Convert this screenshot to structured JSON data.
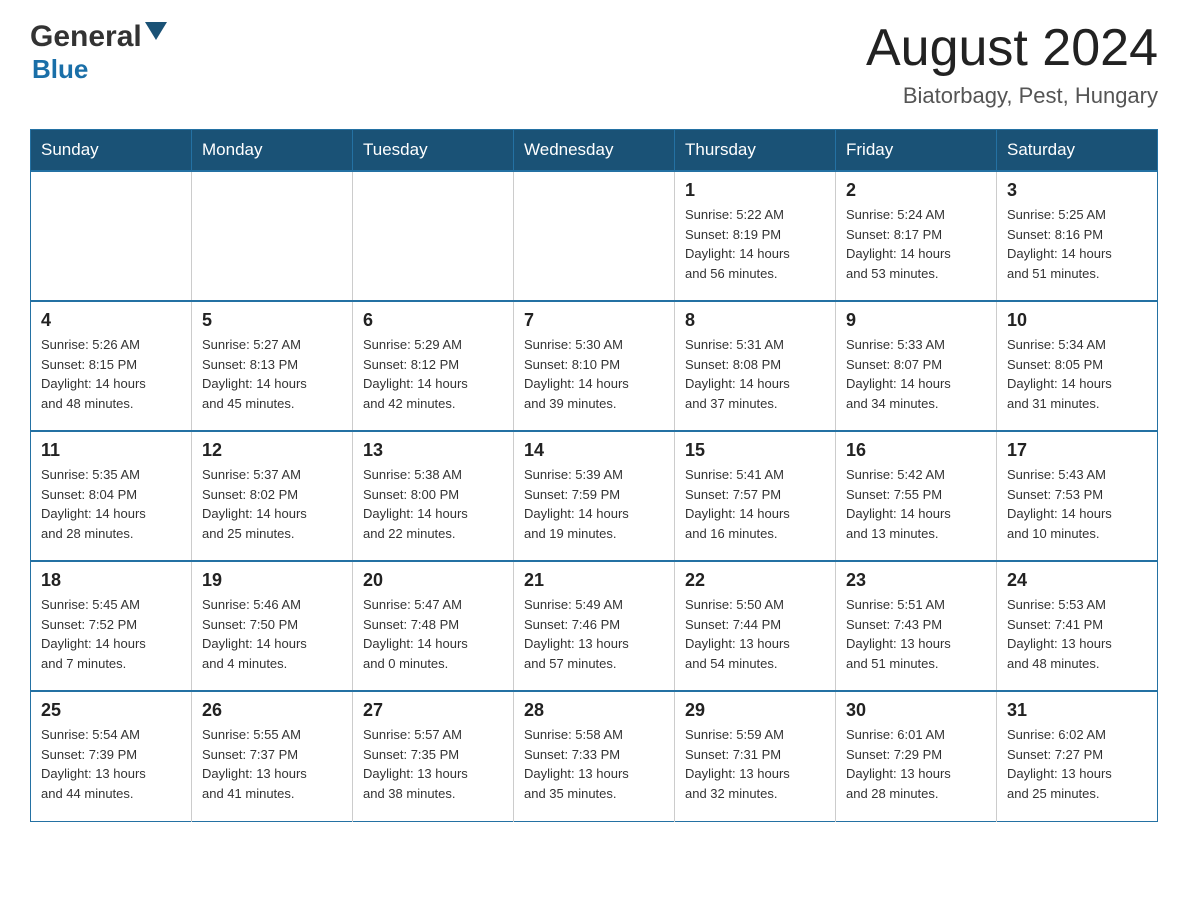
{
  "header": {
    "logo_general": "General",
    "logo_blue": "Blue",
    "title": "August 2024",
    "subtitle": "Biatorbagy, Pest, Hungary"
  },
  "calendar": {
    "days_of_week": [
      "Sunday",
      "Monday",
      "Tuesday",
      "Wednesday",
      "Thursday",
      "Friday",
      "Saturday"
    ],
    "accent_color": "#1a5276",
    "weeks": [
      [
        {
          "day": "",
          "info": ""
        },
        {
          "day": "",
          "info": ""
        },
        {
          "day": "",
          "info": ""
        },
        {
          "day": "",
          "info": ""
        },
        {
          "day": "1",
          "info": "Sunrise: 5:22 AM\nSunset: 8:19 PM\nDaylight: 14 hours\nand 56 minutes."
        },
        {
          "day": "2",
          "info": "Sunrise: 5:24 AM\nSunset: 8:17 PM\nDaylight: 14 hours\nand 53 minutes."
        },
        {
          "day": "3",
          "info": "Sunrise: 5:25 AM\nSunset: 8:16 PM\nDaylight: 14 hours\nand 51 minutes."
        }
      ],
      [
        {
          "day": "4",
          "info": "Sunrise: 5:26 AM\nSunset: 8:15 PM\nDaylight: 14 hours\nand 48 minutes."
        },
        {
          "day": "5",
          "info": "Sunrise: 5:27 AM\nSunset: 8:13 PM\nDaylight: 14 hours\nand 45 minutes."
        },
        {
          "day": "6",
          "info": "Sunrise: 5:29 AM\nSunset: 8:12 PM\nDaylight: 14 hours\nand 42 minutes."
        },
        {
          "day": "7",
          "info": "Sunrise: 5:30 AM\nSunset: 8:10 PM\nDaylight: 14 hours\nand 39 minutes."
        },
        {
          "day": "8",
          "info": "Sunrise: 5:31 AM\nSunset: 8:08 PM\nDaylight: 14 hours\nand 37 minutes."
        },
        {
          "day": "9",
          "info": "Sunrise: 5:33 AM\nSunset: 8:07 PM\nDaylight: 14 hours\nand 34 minutes."
        },
        {
          "day": "10",
          "info": "Sunrise: 5:34 AM\nSunset: 8:05 PM\nDaylight: 14 hours\nand 31 minutes."
        }
      ],
      [
        {
          "day": "11",
          "info": "Sunrise: 5:35 AM\nSunset: 8:04 PM\nDaylight: 14 hours\nand 28 minutes."
        },
        {
          "day": "12",
          "info": "Sunrise: 5:37 AM\nSunset: 8:02 PM\nDaylight: 14 hours\nand 25 minutes."
        },
        {
          "day": "13",
          "info": "Sunrise: 5:38 AM\nSunset: 8:00 PM\nDaylight: 14 hours\nand 22 minutes."
        },
        {
          "day": "14",
          "info": "Sunrise: 5:39 AM\nSunset: 7:59 PM\nDaylight: 14 hours\nand 19 minutes."
        },
        {
          "day": "15",
          "info": "Sunrise: 5:41 AM\nSunset: 7:57 PM\nDaylight: 14 hours\nand 16 minutes."
        },
        {
          "day": "16",
          "info": "Sunrise: 5:42 AM\nSunset: 7:55 PM\nDaylight: 14 hours\nand 13 minutes."
        },
        {
          "day": "17",
          "info": "Sunrise: 5:43 AM\nSunset: 7:53 PM\nDaylight: 14 hours\nand 10 minutes."
        }
      ],
      [
        {
          "day": "18",
          "info": "Sunrise: 5:45 AM\nSunset: 7:52 PM\nDaylight: 14 hours\nand 7 minutes."
        },
        {
          "day": "19",
          "info": "Sunrise: 5:46 AM\nSunset: 7:50 PM\nDaylight: 14 hours\nand 4 minutes."
        },
        {
          "day": "20",
          "info": "Sunrise: 5:47 AM\nSunset: 7:48 PM\nDaylight: 14 hours\nand 0 minutes."
        },
        {
          "day": "21",
          "info": "Sunrise: 5:49 AM\nSunset: 7:46 PM\nDaylight: 13 hours\nand 57 minutes."
        },
        {
          "day": "22",
          "info": "Sunrise: 5:50 AM\nSunset: 7:44 PM\nDaylight: 13 hours\nand 54 minutes."
        },
        {
          "day": "23",
          "info": "Sunrise: 5:51 AM\nSunset: 7:43 PM\nDaylight: 13 hours\nand 51 minutes."
        },
        {
          "day": "24",
          "info": "Sunrise: 5:53 AM\nSunset: 7:41 PM\nDaylight: 13 hours\nand 48 minutes."
        }
      ],
      [
        {
          "day": "25",
          "info": "Sunrise: 5:54 AM\nSunset: 7:39 PM\nDaylight: 13 hours\nand 44 minutes."
        },
        {
          "day": "26",
          "info": "Sunrise: 5:55 AM\nSunset: 7:37 PM\nDaylight: 13 hours\nand 41 minutes."
        },
        {
          "day": "27",
          "info": "Sunrise: 5:57 AM\nSunset: 7:35 PM\nDaylight: 13 hours\nand 38 minutes."
        },
        {
          "day": "28",
          "info": "Sunrise: 5:58 AM\nSunset: 7:33 PM\nDaylight: 13 hours\nand 35 minutes."
        },
        {
          "day": "29",
          "info": "Sunrise: 5:59 AM\nSunset: 7:31 PM\nDaylight: 13 hours\nand 32 minutes."
        },
        {
          "day": "30",
          "info": "Sunrise: 6:01 AM\nSunset: 7:29 PM\nDaylight: 13 hours\nand 28 minutes."
        },
        {
          "day": "31",
          "info": "Sunrise: 6:02 AM\nSunset: 7:27 PM\nDaylight: 13 hours\nand 25 minutes."
        }
      ]
    ]
  }
}
